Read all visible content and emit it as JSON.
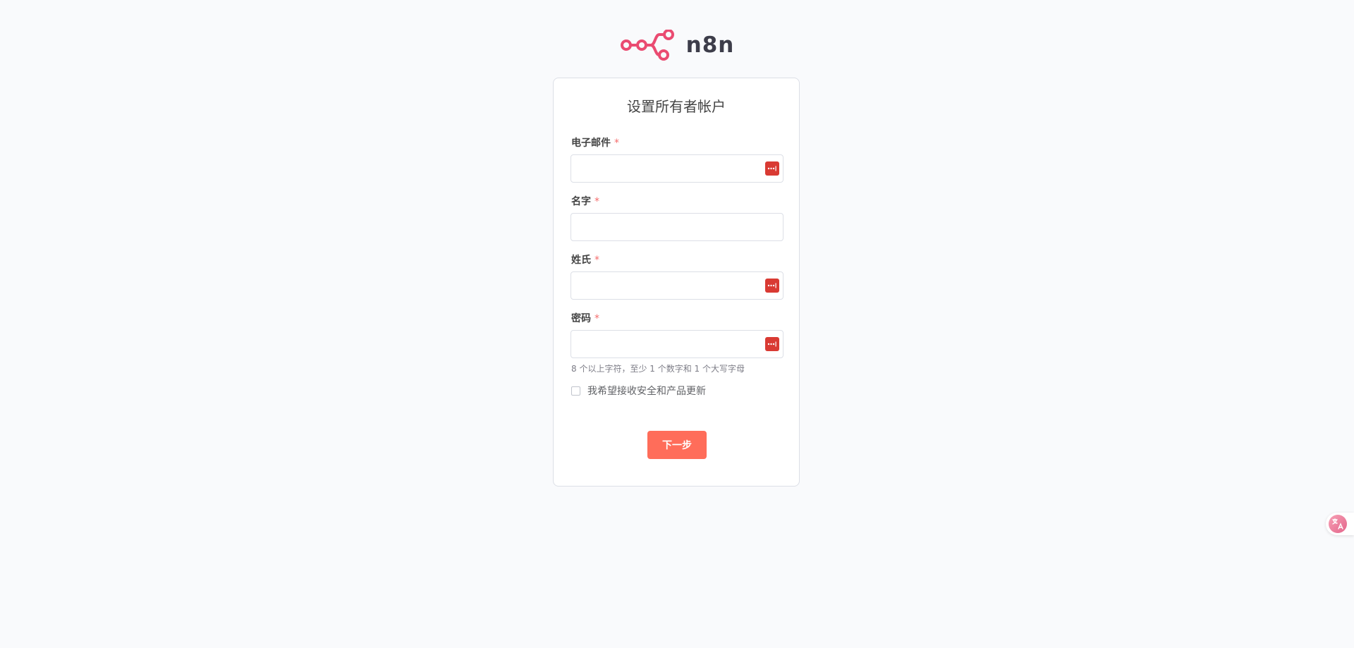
{
  "brand": {
    "name": "n8n",
    "accent": "#ea4b71"
  },
  "form": {
    "title": "设置所有者帐户",
    "required_mark": "*",
    "fields": [
      {
        "label": "电子邮件",
        "value": "",
        "has_password_manager_icon": true
      },
      {
        "label": "名字",
        "value": "",
        "has_password_manager_icon": false
      },
      {
        "label": "姓氏",
        "value": "",
        "has_password_manager_icon": true
      },
      {
        "label": "密码",
        "value": "",
        "has_password_manager_icon": true
      }
    ],
    "password_hint": "8 个以上字符，至少 1 个数字和 1 个大写字母",
    "updates_checkbox": {
      "label": "我希望接收安全和产品更新",
      "checked": false
    },
    "submit_label": "下一步"
  },
  "colors": {
    "primary_button": "#ff6d5a",
    "required": "#f56c6c",
    "password_manager_icon": "#d93a33",
    "background": "#f9fafc"
  },
  "icons": {
    "password_manager": "password-manager-icon",
    "translate": "translate-icon"
  }
}
